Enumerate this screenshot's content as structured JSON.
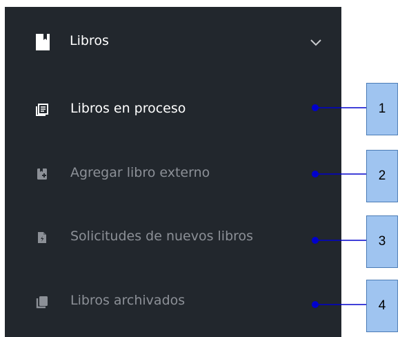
{
  "sidebar": {
    "header": {
      "label": "Libros",
      "icon": "book-icon",
      "chevron": "chevron-down-icon"
    },
    "items": [
      {
        "label": "Libros en proceso",
        "icon": "book-list-icon",
        "state": "active"
      },
      {
        "label": "Agregar libro externo",
        "icon": "book-add-icon",
        "state": "muted"
      },
      {
        "label": "Solicitudes de nuevos libros",
        "icon": "file-request-icon",
        "state": "muted"
      },
      {
        "label": "Libros archivados",
        "icon": "books-archived-icon",
        "state": "muted"
      }
    ]
  },
  "callouts": [
    "1",
    "2",
    "3",
    "4"
  ],
  "colors": {
    "sidebar_bg": "#22272d",
    "active_text": "#ffffff",
    "muted_text": "#8c9097",
    "callout_fill": "#9fc4f0",
    "callout_line": "#0000cc"
  }
}
